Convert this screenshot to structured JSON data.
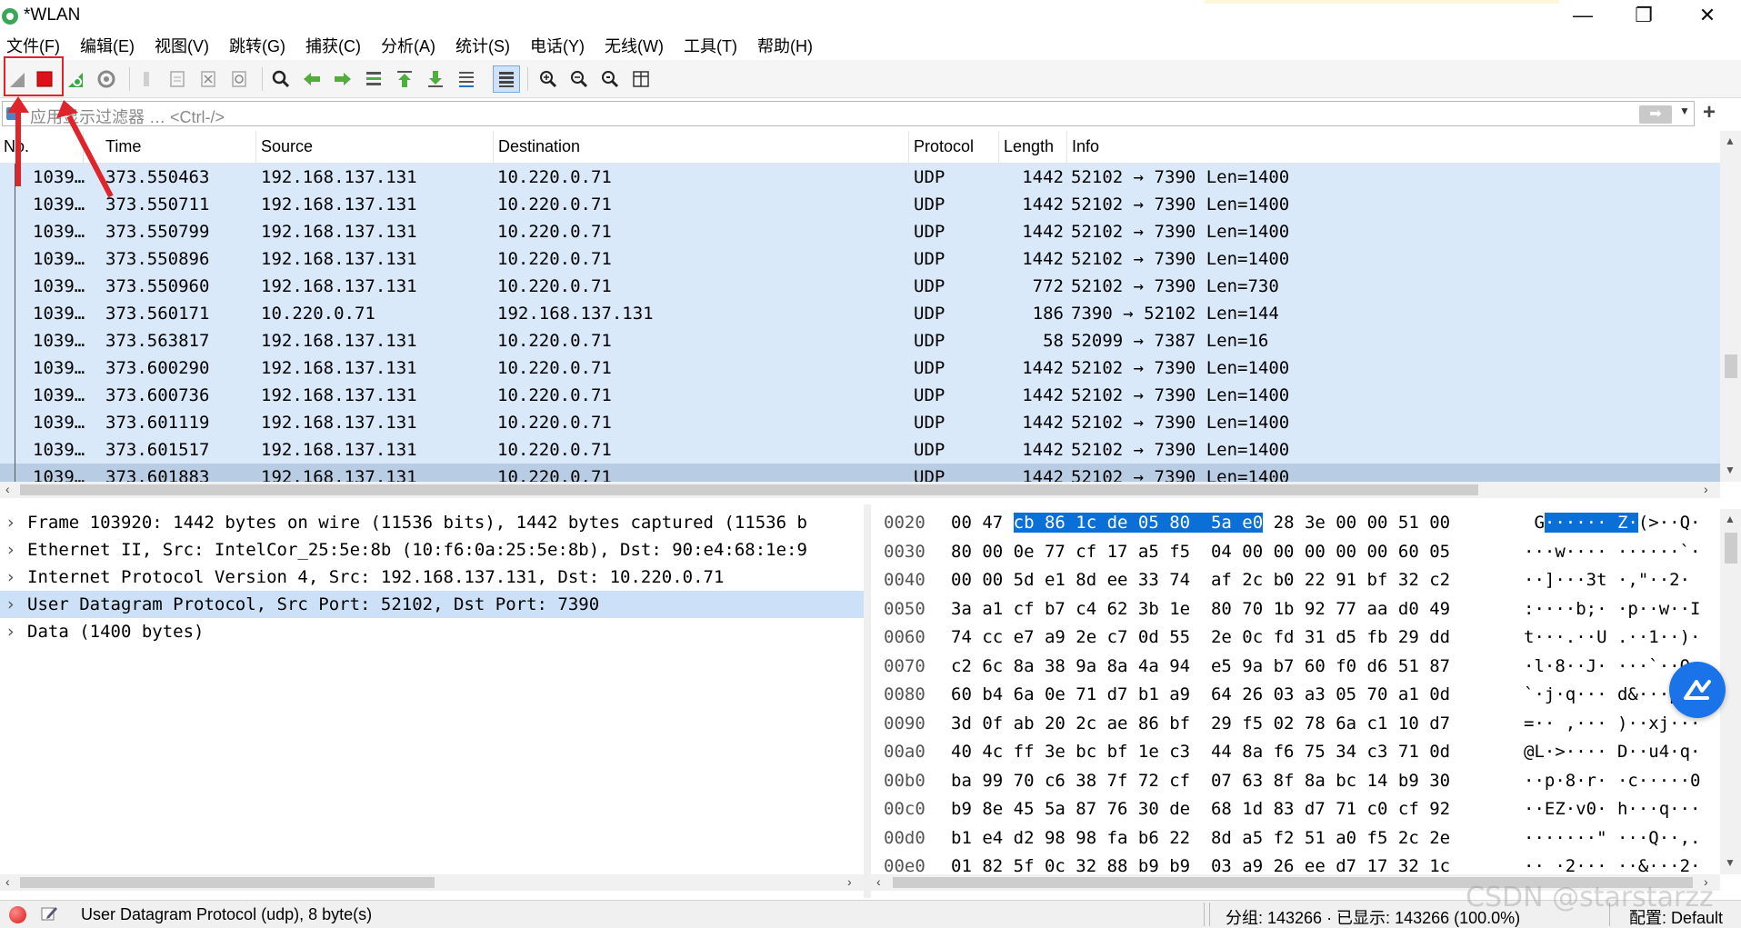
{
  "window": {
    "title": "*WLAN",
    "minimize_glyph": "—",
    "restore_glyph": "❐",
    "close_glyph": "✕"
  },
  "menu": [
    "文件(F)",
    "编辑(E)",
    "视图(V)",
    "跳转(G)",
    "捕获(C)",
    "分析(A)",
    "统计(S)",
    "电话(Y)",
    "无线(W)",
    "工具(T)",
    "帮助(H)"
  ],
  "toolbar": {
    "icons": [
      "start-capture-icon",
      "stop-capture-icon",
      "restart-capture-icon",
      "capture-options-icon",
      "open-file-icon",
      "save-file-icon",
      "close-file-icon",
      "reload-file-icon",
      "find-packet-icon",
      "go-back-icon",
      "go-forward-icon",
      "go-to-packet-icon",
      "go-first-icon",
      "go-last-icon",
      "autoscroll-icon",
      "colorize-icon",
      "zoom-in-icon",
      "zoom-out-icon",
      "zoom-normal-icon",
      "resize-columns-icon"
    ]
  },
  "filter": {
    "placeholder": "应用显示过滤器 … <Ctrl-/>",
    "apply_glyph": "➡",
    "dropdown_glyph": "▼",
    "add_glyph": "+"
  },
  "packet_list": {
    "columns": [
      "No.",
      "Time",
      "Source",
      "Destination",
      "Protocol",
      "Length",
      "Info"
    ],
    "rows": [
      {
        "no": "1039…",
        "time": "373.550463",
        "source": "192.168.137.131",
        "destination": "10.220.0.71",
        "protocol": "UDP",
        "length": "1442",
        "info": "52102 → 7390 Len=1400"
      },
      {
        "no": "1039…",
        "time": "373.550711",
        "source": "192.168.137.131",
        "destination": "10.220.0.71",
        "protocol": "UDP",
        "length": "1442",
        "info": "52102 → 7390 Len=1400"
      },
      {
        "no": "1039…",
        "time": "373.550799",
        "source": "192.168.137.131",
        "destination": "10.220.0.71",
        "protocol": "UDP",
        "length": "1442",
        "info": "52102 → 7390 Len=1400"
      },
      {
        "no": "1039…",
        "time": "373.550896",
        "source": "192.168.137.131",
        "destination": "10.220.0.71",
        "protocol": "UDP",
        "length": "1442",
        "info": "52102 → 7390 Len=1400"
      },
      {
        "no": "1039…",
        "time": "373.550960",
        "source": "192.168.137.131",
        "destination": "10.220.0.71",
        "protocol": "UDP",
        "length": "772",
        "info": "52102 → 7390 Len=730"
      },
      {
        "no": "1039…",
        "time": "373.560171",
        "source": "10.220.0.71",
        "destination": "192.168.137.131",
        "protocol": "UDP",
        "length": "186",
        "info": "7390 → 52102 Len=144"
      },
      {
        "no": "1039…",
        "time": "373.563817",
        "source": "192.168.137.131",
        "destination": "10.220.0.71",
        "protocol": "UDP",
        "length": "58",
        "info": "52099 → 7387 Len=16"
      },
      {
        "no": "1039…",
        "time": "373.600290",
        "source": "192.168.137.131",
        "destination": "10.220.0.71",
        "protocol": "UDP",
        "length": "1442",
        "info": "52102 → 7390 Len=1400"
      },
      {
        "no": "1039…",
        "time": "373.600736",
        "source": "192.168.137.131",
        "destination": "10.220.0.71",
        "protocol": "UDP",
        "length": "1442",
        "info": "52102 → 7390 Len=1400"
      },
      {
        "no": "1039…",
        "time": "373.601119",
        "source": "192.168.137.131",
        "destination": "10.220.0.71",
        "protocol": "UDP",
        "length": "1442",
        "info": "52102 → 7390 Len=1400"
      },
      {
        "no": "1039…",
        "time": "373.601517",
        "source": "192.168.137.131",
        "destination": "10.220.0.71",
        "protocol": "UDP",
        "length": "1442",
        "info": "52102 → 7390 Len=1400"
      },
      {
        "no": "1039…",
        "time": "373.601883",
        "source": "192.168.137.131",
        "destination": "10.220.0.71",
        "protocol": "UDP",
        "length": "1442",
        "info": "52102 → 7390 Len=1400"
      }
    ]
  },
  "details": {
    "expand_glyph": "›",
    "items": [
      "Frame 103920: 1442 bytes on wire (11536 bits), 1442 bytes captured (11536 b",
      "Ethernet II, Src: IntelCor_25:5e:8b (10:f6:0a:25:5e:8b), Dst: 90:e4:68:1e:9",
      "Internet Protocol Version 4, Src: 192.168.137.131, Dst: 10.220.0.71",
      "User Datagram Protocol, Src Port: 52102, Dst Port: 7390",
      "Data (1400 bytes)"
    ]
  },
  "bytes": {
    "rows": [
      {
        "offset": "0020",
        "hex_pre": "00 47 ",
        "hex_hl": "cb 86 1c de 05 80  5a e0",
        "hex_post": " 28 3e 00 00 51 00",
        "ascii_pre": " G",
        "ascii_hl": "······ Z·",
        "ascii_post": "(>··Q·"
      },
      {
        "offset": "0030",
        "hex_pre": "80 00 0e 77 cf 17 a5 f5  04 00 00 00 00 00 60 05",
        "hex_hl": "",
        "hex_post": "",
        "ascii_pre": "···w···· ······`·",
        "ascii_hl": "",
        "ascii_post": ""
      },
      {
        "offset": "0040",
        "hex_pre": "00 00 5d e1 8d ee 33 74  af 2c b0 22 91 bf 32 c2",
        "hex_hl": "",
        "hex_post": "",
        "ascii_pre": "··]···3t ·,\"··2·",
        "ascii_hl": "",
        "ascii_post": ""
      },
      {
        "offset": "0050",
        "hex_pre": "3a a1 cf b7 c4 62 3b 1e  80 70 1b 92 77 aa d0 49",
        "hex_hl": "",
        "hex_post": "",
        "ascii_pre": ":····b;· ·p··w··I",
        "ascii_hl": "",
        "ascii_post": ""
      },
      {
        "offset": "0060",
        "hex_pre": "74 cc e7 a9 2e c7 0d 55  2e 0c fd 31 d5 fb 29 dd",
        "hex_hl": "",
        "hex_post": "",
        "ascii_pre": "t···.··U .··1··)·",
        "ascii_hl": "",
        "ascii_post": ""
      },
      {
        "offset": "0070",
        "hex_pre": "c2 6c 8a 38 9a 8a 4a 94  e5 9a b7 60 f0 d6 51 87",
        "hex_hl": "",
        "hex_post": "",
        "ascii_pre": "·l·8··J· ···`··Q·",
        "ascii_hl": "",
        "ascii_post": ""
      },
      {
        "offset": "0080",
        "hex_pre": "60 b4 6a 0e 71 d7 b1 a9  64 26 03 a3 05 70 a1 0d",
        "hex_hl": "",
        "hex_post": "",
        "ascii_pre": "`·j·q··· d&···p··",
        "ascii_hl": "",
        "ascii_post": ""
      },
      {
        "offset": "0090",
        "hex_pre": "3d 0f ab 20 2c ae 86 bf  29 f5 02 78 6a c1 10 d7",
        "hex_hl": "",
        "hex_post": "",
        "ascii_pre": "=·· ,··· )··xj···",
        "ascii_hl": "",
        "ascii_post": ""
      },
      {
        "offset": "00a0",
        "hex_pre": "40 4c ff 3e bc bf 1e c3  44 8a f6 75 34 c3 71 0d",
        "hex_hl": "",
        "hex_post": "",
        "ascii_pre": "@L·>···· D··u4·q·",
        "ascii_hl": "",
        "ascii_post": ""
      },
      {
        "offset": "00b0",
        "hex_pre": "ba 99 70 c6 38 7f 72 cf  07 63 8f 8a bc 14 b9 30",
        "hex_hl": "",
        "hex_post": "",
        "ascii_pre": "··p·8·r· ·c·····0",
        "ascii_hl": "",
        "ascii_post": ""
      },
      {
        "offset": "00c0",
        "hex_pre": "b9 8e 45 5a 87 76 30 de  68 1d 83 d7 71 c0 cf 92",
        "hex_hl": "",
        "hex_post": "",
        "ascii_pre": "··EZ·v0· h···q···",
        "ascii_hl": "",
        "ascii_post": ""
      },
      {
        "offset": "00d0",
        "hex_pre": "b1 e4 d2 98 98 fa b6 22  8d a5 f2 51 a0 f5 2c 2e",
        "hex_hl": "",
        "hex_post": "",
        "ascii_pre": "·······\" ···Q··,.",
        "ascii_hl": "",
        "ascii_post": ""
      },
      {
        "offset": "00e0",
        "hex_pre": "01 82 5f 0c 32 88 b9 b9  03 a9 26 ee d7 17 32 1c",
        "hex_hl": "",
        "hex_post": "",
        "ascii_pre": "··_·2··· ··&···2·",
        "ascii_hl": "",
        "ascii_post": ""
      }
    ]
  },
  "status": {
    "message": "User Datagram Protocol (udp), 8 byte(s)",
    "packets": "分组: 143266 · 已显示: 143266 (100.0%)",
    "profile": "配置: Default"
  },
  "watermark": "CSDN @starstarzz",
  "colors": {
    "row_bg": "#dae9fa",
    "row_selected": "#b8cce4",
    "detail_selected": "#cce1f7",
    "hex_highlight": "#0a6fd6",
    "annotation_red": "#e0242b"
  }
}
